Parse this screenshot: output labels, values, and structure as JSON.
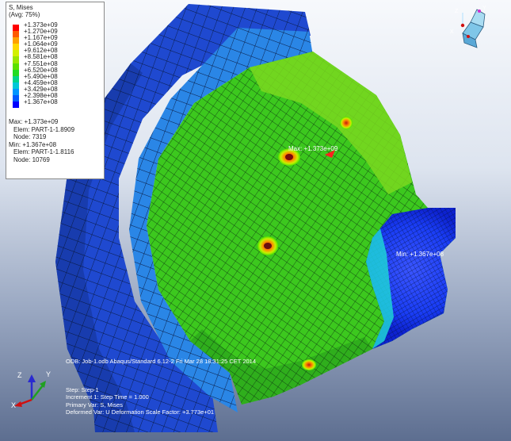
{
  "legend": {
    "title": "S, Mises",
    "avg": "(Avg: 75%)",
    "values": [
      "+1.373e+09",
      "+1.270e+09",
      "+1.167e+09",
      "+1.064e+09",
      "+9.612e+08",
      "+8.581e+08",
      "+7.551e+08",
      "+6.520e+08",
      "+5.490e+08",
      "+4.459e+08",
      "+3.429e+08",
      "+2.398e+08",
      "+1.367e+08"
    ],
    "colors": [
      "#ff0000",
      "#ff5a00",
      "#ffa000",
      "#ffd700",
      "#d2f000",
      "#9ae600",
      "#5ce000",
      "#22dc22",
      "#00d48a",
      "#00c8d8",
      "#0096ff",
      "#005aff",
      "#0000ff"
    ],
    "max_label": "Max: +1.373e+09",
    "max_elem": "Elem: PART-1-1.8909",
    "max_node": "Node: 7319",
    "min_label": "Min: +1.367e+08",
    "min_elem": "Elem: PART-1-1.8116",
    "min_node": "Node: 10769"
  },
  "model": {
    "max_tag": "Max: +1.373e+09",
    "min_tag": "Min: +1.367e+08"
  },
  "footer": {
    "odb": "ODB: Job-1.odb    Abaqus/Standard 6.12-2    Fri Mar 28 18:31:25 CET 2014",
    "step": "Step: Step-1",
    "increment": "Increment      1: Step Time =    1.000",
    "primary": "Primary Var: S, Mises",
    "deformed": "Deformed Var: U   Deformation Scale Factor: +3.773e+01"
  },
  "triad": {
    "x": "X",
    "y": "Y",
    "z": "Z"
  },
  "viewcube": {
    "x": "X",
    "y": "Y",
    "z": "Z"
  }
}
